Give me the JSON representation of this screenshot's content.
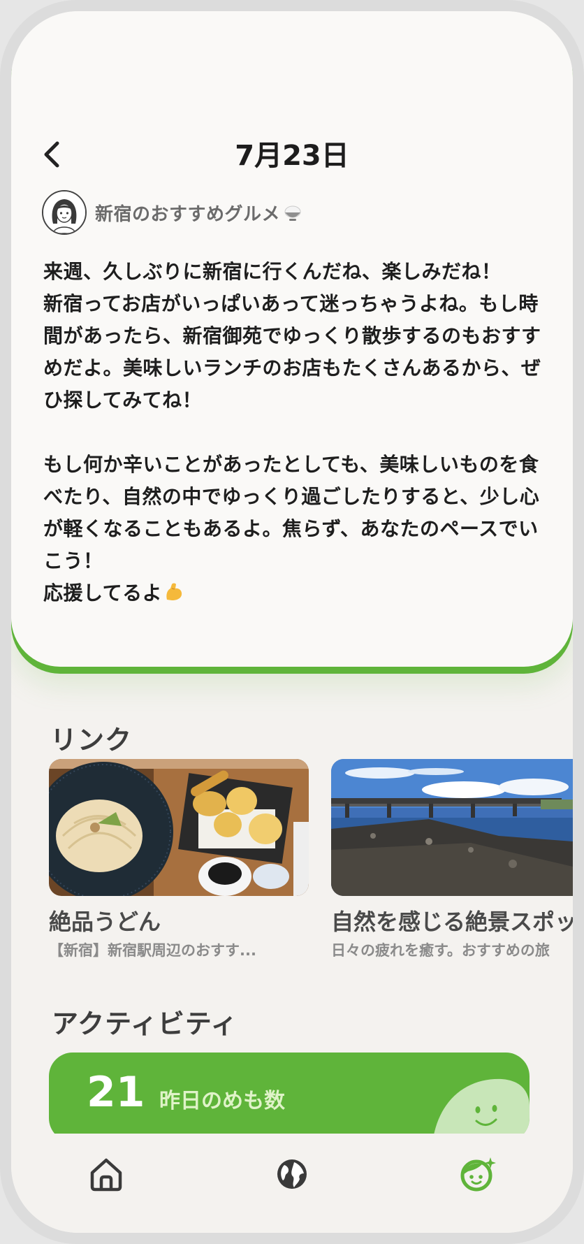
{
  "header": {
    "title": "7月23日",
    "back_icon": "chevron-left-icon"
  },
  "post": {
    "author_name": "新宿のおすすめグルメ",
    "author_icon": "rice-bowl-icon",
    "paragraphs": [
      "来週、久しぶりに新宿に行くんだね、楽しみだね！\n新宿ってお店がいっぱいあって迷っちゃうよね。もし時間があったら、新宿御苑でゆっくり散歩するのもおすすめだよ。美味しいランチのお店もたくさんあるから、ぜひ探してみてね！",
      "もし何か辛いことがあったとしても、美味しいものを食べたり、自然の中でゆっくり過ごしたりすると、少し心が軽くなることもあるよ。焦らず、あなたのペースでいこう！\n応援してるよ"
    ],
    "closing_icon": "flexed-biceps-icon"
  },
  "links": {
    "title": "リンク",
    "items": [
      {
        "title": "絶品うどん",
        "description": "【新宿】新宿駅周辺のおすす...",
        "image": "udon-tempura-photo"
      },
      {
        "title": "自然を感じる絶景スポット",
        "description": "日々の疲れを癒す。おすすめの旅",
        "image": "river-bridge-photo"
      }
    ]
  },
  "activity": {
    "title": "アクティビティ",
    "count": "21",
    "label": "昨日のめも数"
  },
  "nav": {
    "items": [
      {
        "icon": "home-icon"
      },
      {
        "icon": "globe-icon"
      },
      {
        "icon": "profile-face-icon"
      }
    ]
  },
  "colors": {
    "accent_green": "#5fb43a",
    "background": "#f4f2ef",
    "card": "#faf9f7",
    "text": "#1e1e1e"
  }
}
